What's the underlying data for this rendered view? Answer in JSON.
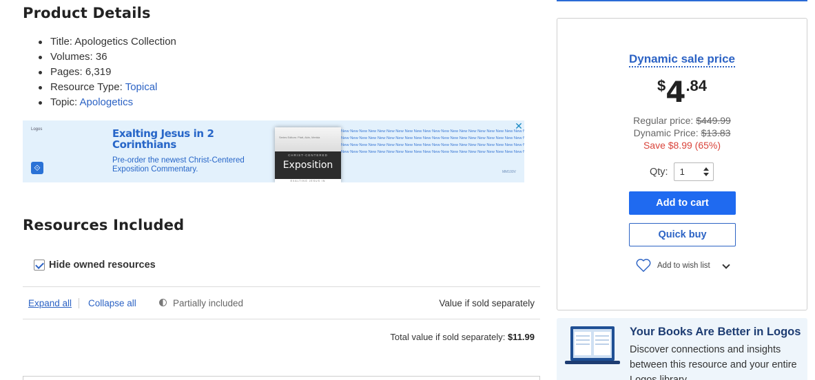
{
  "product_details": {
    "heading": "Product Details",
    "items": [
      {
        "label": "Title: ",
        "value": "Apologetics Collection",
        "is_link": false
      },
      {
        "label": "Volumes: ",
        "value": "36",
        "is_link": false
      },
      {
        "label": "Pages: ",
        "value": "6,319",
        "is_link": false
      },
      {
        "label": "Resource Type: ",
        "value": "Topical",
        "is_link": true
      },
      {
        "label": "Topic: ",
        "value": "Apologetics",
        "is_link": true
      }
    ]
  },
  "ad": {
    "brand": "Logos",
    "headline": "Exalting Jesus in 2 Corinthians",
    "subtext": "Pre-order the newest Christ-Centered Exposition Commentary.",
    "book_small": "CHRIST-CENTERED",
    "book_title": "Exposition",
    "book_footer": "EXALTING JESUS IN",
    "book_authors": "Series Editors: Platt, Akin, Merida",
    "new_word": "New",
    "code": "MM100V",
    "close_glyph": "✕"
  },
  "resources": {
    "heading": "Resources Included",
    "hide_owned_label": "Hide owned resources",
    "hide_owned_checked": true,
    "expand_all": "Expand all",
    "collapse_all": "Collapse all",
    "partially_included": "Partially included",
    "value_if_sold": "Value if sold separately",
    "total_label": "Total value if sold separately:",
    "total_value": "$11.99"
  },
  "purchase": {
    "dynamic_title": "Dynamic sale price",
    "currency": "$",
    "dollars": "4",
    "cents": ".84",
    "regular_label": "Regular price:",
    "regular_value": "$449.99",
    "dynamic_label": "Dynamic Price:",
    "dynamic_value": "$13.83",
    "save_text": "Save $8.99 (65%)",
    "qty_label": "Qty:",
    "qty_value": "1",
    "add_to_cart": "Add to cart",
    "quick_buy": "Quick buy",
    "wish_list": "Add to wish list"
  },
  "promo": {
    "title": "Your Books Are Better in Logos",
    "text": "Discover connections and insights between this resource and your entire Logos library"
  },
  "colors": {
    "link": "#2b62c4",
    "primary_button": "#1f6af0",
    "save_red": "#d9433a",
    "promo_title": "#1d3c72"
  }
}
